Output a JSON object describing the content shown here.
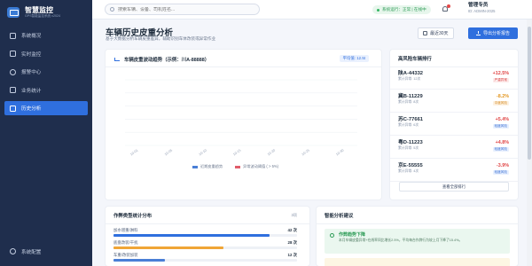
{
  "brand": {
    "title": "智慧监控",
    "subtitle": "GPS智能监控系统 v2024"
  },
  "sidebar": {
    "items": [
      {
        "label": "系统概况",
        "icon": "grid-icon",
        "active": false
      },
      {
        "label": "实时监控",
        "icon": "monitor-icon",
        "active": false
      },
      {
        "label": "报警中心",
        "icon": "alarm-icon",
        "active": false
      },
      {
        "label": "业务统计",
        "icon": "chart-icon",
        "active": false
      },
      {
        "label": "历史分析",
        "icon": "history-icon",
        "active": true
      }
    ],
    "bottom": {
      "label": "系统配置",
      "icon": "gear-icon"
    }
  },
  "topbar": {
    "search_placeholder": "搜索车辆、设备、司机姓名...",
    "status": "系统运行：正常 | 在线中",
    "user_name": "管理专员",
    "user_role": "ID: ADMIN-2025"
  },
  "page": {
    "title": "车辆历史皮重分析",
    "description": "基于大数据分析车辆皮重差异，辅助识别车体改装或异常作业",
    "range_label": "最近30天",
    "export_label": "导出分析报告"
  },
  "trend": {
    "title": "车辆皮重波动趋势（示例：川A-88888）",
    "badge": "平均值: 12.5t",
    "x_labels": [
      "10-01",
      "10-05",
      "10-10",
      "10-15",
      "10-20",
      "10-25",
      "10-30"
    ],
    "legend": [
      {
        "label": "近期皮重趋势",
        "color": "#4a7fd6"
      },
      {
        "label": "异常波动阈值 ( > 5%)",
        "color": "#e05c6a"
      }
    ]
  },
  "ranking": {
    "title": "高风险车辆排行",
    "items": [
      {
        "plate": "陕A-44332",
        "sub": "累计异常: 12次",
        "change": "+12.5%",
        "tag": "严重异常",
        "level": "red"
      },
      {
        "plate": "冀B-11229",
        "sub": "累计异常: 8次",
        "change": "-8.2%",
        "tag": "中度风险",
        "level": "orange"
      },
      {
        "plate": "苏C-77661",
        "sub": "累计异常: 6次",
        "change": "+5.4%",
        "tag": "轻度风险",
        "level": "blue"
      },
      {
        "plate": "粤D-11223",
        "sub": "累计异常: 5次",
        "change": "+4.8%",
        "tag": "轻度风险",
        "level": "blue"
      },
      {
        "plate": "京E-55555",
        "sub": "累计异常: 4次",
        "change": "-3.9%",
        "tag": "轻度风险",
        "level": "blue"
      }
    ],
    "more_label": "查看全部排行"
  },
  "types": {
    "title": "作弊类型统计分布",
    "count_label": "3项",
    "items": [
      {
        "label": "加水增重/淋料",
        "value": "42 次",
        "ratio": 0.85,
        "color": "#2f6fde"
      },
      {
        "label": "底盘改装/干扰",
        "value": "28 次",
        "ratio": 0.6,
        "color": "#f0a536"
      },
      {
        "label": "车重/改装加装",
        "value": "12 次",
        "ratio": 0.28,
        "color": "#4a7fd6"
      }
    ]
  },
  "advice": {
    "title": "智能分析建议",
    "card_title": "作弊趋势下降",
    "card_text": "本月车辆皮重异常+在线率同比增长2.5%，平均每台作弊行为较上月下降了15.4%。"
  }
}
